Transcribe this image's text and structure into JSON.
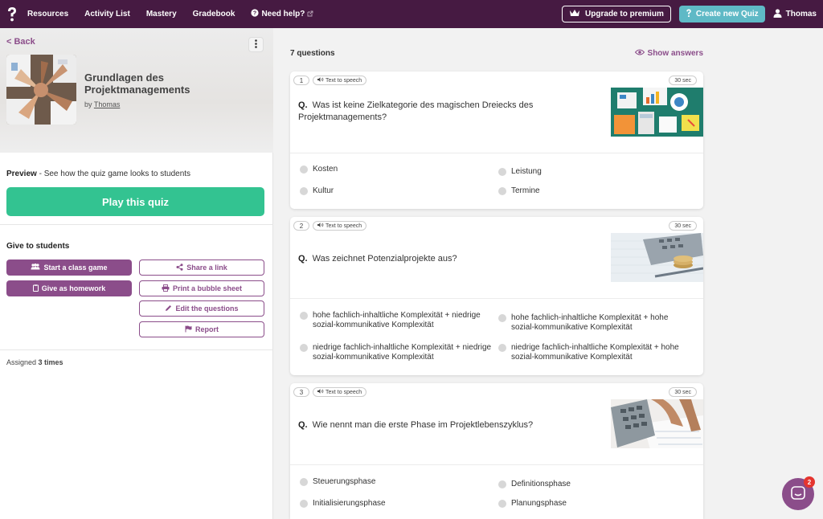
{
  "nav": {
    "items": [
      "Resources",
      "Activity List",
      "Mastery",
      "Gradebook"
    ],
    "help": "Need help?",
    "upgrade": "Upgrade to premium",
    "create": "Create new Quiz",
    "user": "Thomas"
  },
  "quiz": {
    "back": "< Back",
    "title": "Grundlagen des Projektmanagements",
    "by_prefix": "by",
    "author": "Thomas",
    "preview_bold": "Preview",
    "preview_rest": " - See how the quiz game looks to students",
    "play": "Play this quiz",
    "give_title": "Give to students",
    "buttons": {
      "class_game": "Start a class game",
      "homework": "Give as homework",
      "share": "Share a link",
      "print": "Print a bubble sheet",
      "edit": "Edit the questions",
      "report": "Report"
    },
    "assigned_prefix": "Assigned ",
    "assigned_count": "3 times"
  },
  "questions_header": {
    "count": "7 questions",
    "show_answers": "Show answers"
  },
  "questions": [
    {
      "number": "1",
      "tts": "Text to speech",
      "time": "30 sec",
      "prefix": "Q.",
      "text": "Was ist keine Zielkategorie des magischen Dreiecks des Projektmanagements?",
      "options": [
        "Kosten",
        "Leistung",
        "Kultur",
        "Termine"
      ]
    },
    {
      "number": "2",
      "tts": "Text to speech",
      "time": "30 sec",
      "prefix": "Q.",
      "text": "Was zeichnet Potenzialprojekte aus?",
      "options": [
        "hohe fachlich-inhaltliche Komplexität + niedrige sozial-kommunikative Komplexität",
        "hohe fachlich-inhaltliche Komplexität + hohe sozial-kommunikative Komplexität",
        "niedrige fachlich-inhaltliche Komplexität + niedrige sozial-kommunikative Komplexität",
        "niedrige fachlich-inhaltliche Komplexität + hohe sozial-kommunikative Komplexität"
      ]
    },
    {
      "number": "3",
      "tts": "Text to speech",
      "time": "30 sec",
      "prefix": "Q.",
      "text": "Wie nennt man die erste Phase im Projektlebenszyklus?",
      "options": [
        "Steuerungsphase",
        "Definitionsphase",
        "Initialisierungsphase",
        "Planungsphase"
      ]
    }
  ],
  "chat": {
    "badge": "2"
  },
  "colors": {
    "nav": "#461a42",
    "accent": "#8b4d8a",
    "play": "#33c391",
    "create": "#5fb9c6"
  }
}
